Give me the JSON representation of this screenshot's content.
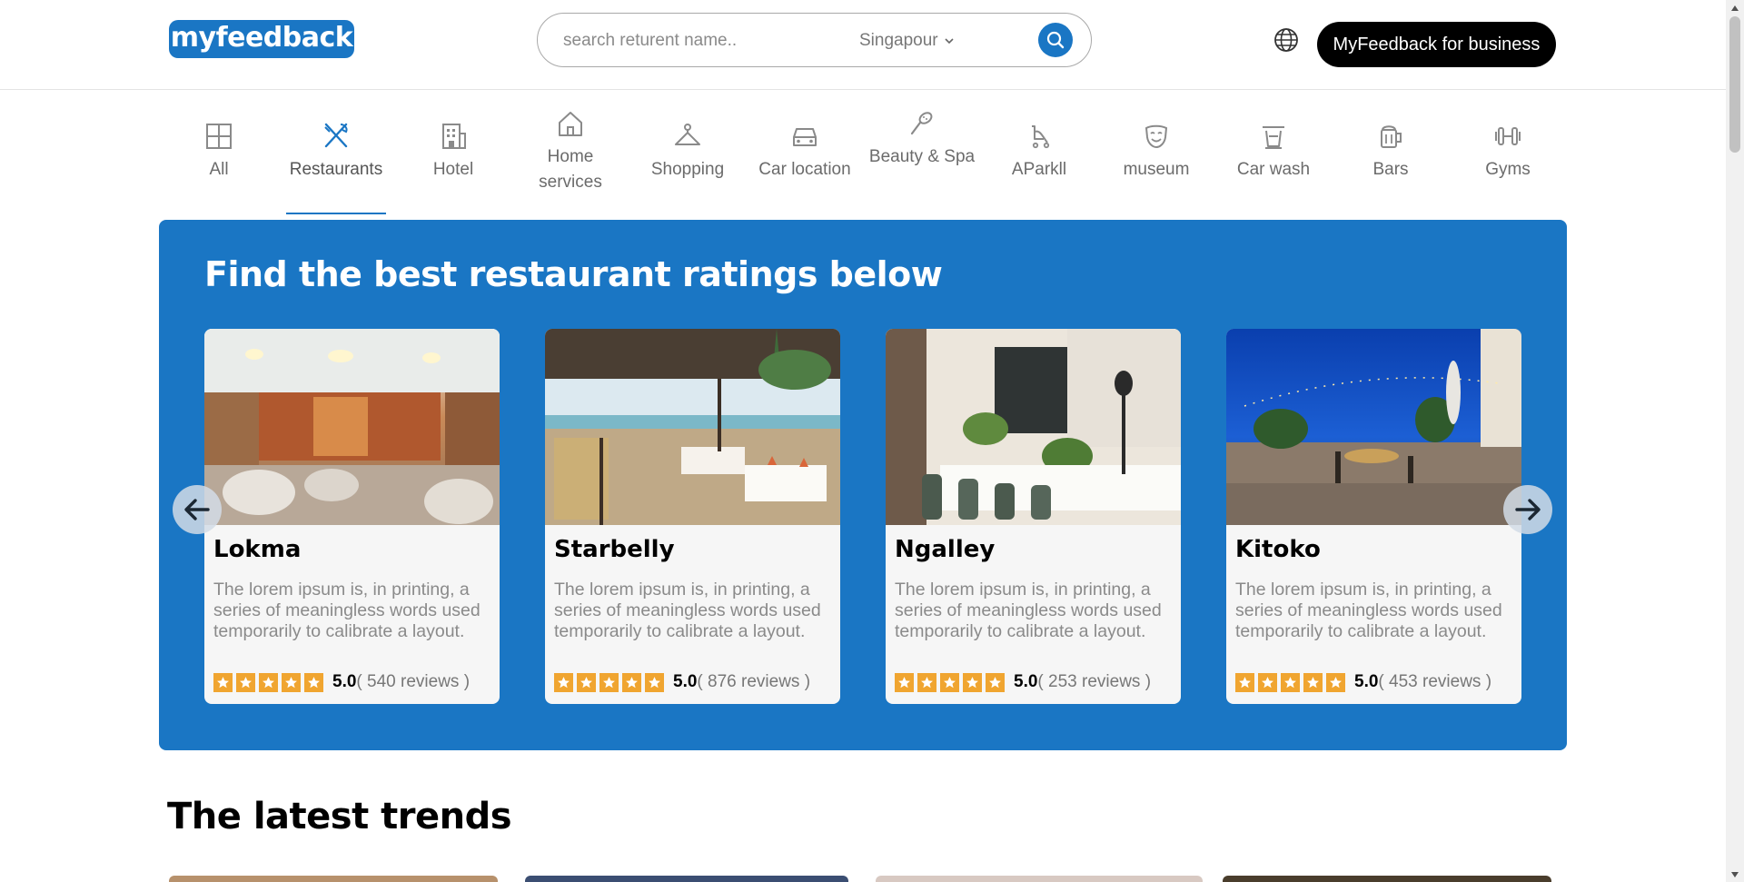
{
  "header": {
    "logo_text": "myfeedback",
    "search_placeholder": "search returent name..",
    "city": "Singapour",
    "business_button": "MyFeedback for business"
  },
  "categories": [
    {
      "label": "All",
      "icon": "grid-icon",
      "active": false
    },
    {
      "label": "Restaurants",
      "icon": "utensils-icon",
      "active": true
    },
    {
      "label": "Hotel",
      "icon": "building-icon",
      "active": false
    },
    {
      "label": "Home services",
      "icon": "house-icon",
      "active": false
    },
    {
      "label": "Shopping",
      "icon": "hanger-icon",
      "active": false
    },
    {
      "label": "Car location",
      "icon": "car-icon",
      "active": false
    },
    {
      "label": "Beauty & Spa",
      "icon": "spa-icon",
      "active": false
    },
    {
      "label": "AParkll",
      "icon": "stroller-icon",
      "active": false
    },
    {
      "label": "museum",
      "icon": "mask-icon",
      "active": false
    },
    {
      "label": "Car wash",
      "icon": "car-wash-icon",
      "active": false
    },
    {
      "label": "Bars",
      "icon": "beer-icon",
      "active": false
    },
    {
      "label": "Gyms",
      "icon": "dumbbell-icon",
      "active": false
    }
  ],
  "banner": {
    "title": "Find the best restaurant ratings below",
    "cards": [
      {
        "name": "Lokma",
        "description": "The lorem ipsum is, in printing, a series of meaningless words used temporarily to calibrate a layout.",
        "stars": 5,
        "score": "5.0",
        "reviews": "( 540 reviews )"
      },
      {
        "name": "Starbelly",
        "description": "The lorem ipsum is, in printing, a series of meaningless words used temporarily to calibrate a layout.",
        "stars": 5,
        "score": "5.0",
        "reviews": "( 876 reviews )"
      },
      {
        "name": "Ngalley",
        "description": "The lorem ipsum is, in printing, a series of meaningless words used temporarily to calibrate a layout.",
        "stars": 5,
        "score": "5.0",
        "reviews": "( 253 reviews )"
      },
      {
        "name": "Kitoko",
        "description": "The lorem ipsum is, in printing, a series of meaningless words used temporarily to calibrate a layout.",
        "stars": 5,
        "score": "5.0",
        "reviews": "( 453 reviews )"
      }
    ]
  },
  "trends": {
    "title": "The latest trends"
  },
  "colors": {
    "brand_blue": "#1a76c4",
    "star_orange": "#f0a530",
    "black_button": "#000000"
  }
}
